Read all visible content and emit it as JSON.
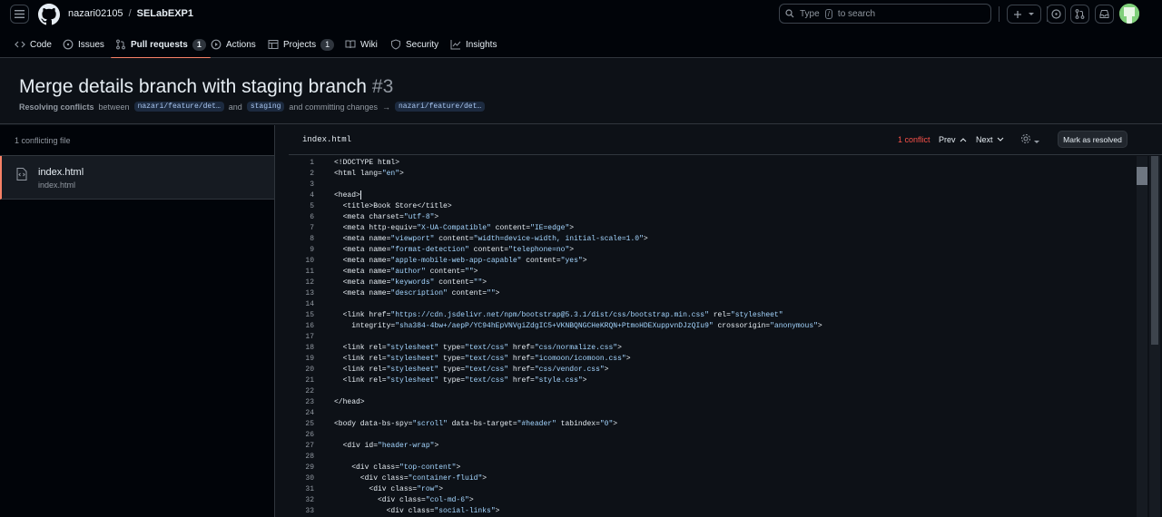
{
  "header": {
    "owner": "nazari02105",
    "separator": "/",
    "repo": "SELabEXP1",
    "search": {
      "prefix": "Type",
      "key": "/",
      "suffix": "to search"
    }
  },
  "tabs": [
    {
      "label": "Code",
      "icon": "code-icon"
    },
    {
      "label": "Issues",
      "icon": "issue-icon"
    },
    {
      "label": "Pull requests",
      "icon": "pull-request-icon",
      "count": "1",
      "active": true
    },
    {
      "label": "Actions",
      "icon": "play-icon"
    },
    {
      "label": "Projects",
      "icon": "table-icon",
      "count": "1"
    },
    {
      "label": "Wiki",
      "icon": "book-icon"
    },
    {
      "label": "Security",
      "icon": "shield-icon"
    },
    {
      "label": "Insights",
      "icon": "graph-icon"
    }
  ],
  "pr": {
    "title": "Merge details branch with staging branch",
    "number": "#3",
    "sub": {
      "action": "Resolving conflicts",
      "between": "between",
      "head": "nazari/feature/det…",
      "and": "and",
      "base": "staging",
      "committing": "and committing changes",
      "arrow": "→",
      "target": "nazari/feature/det…"
    }
  },
  "files": {
    "header": "1 conflicting file",
    "items": [
      {
        "name": "index.html",
        "path": "index.html"
      }
    ]
  },
  "editor": {
    "filename": "index.html",
    "conflicts": "1 conflict",
    "prev": "Prev",
    "next": "Next",
    "resolve": "Mark as resolved",
    "lines": [
      {
        "n": "1",
        "code": "<!DOCTYPE html>"
      },
      {
        "n": "2",
        "code": "<html lang=\"en\">"
      },
      {
        "n": "3",
        "code": ""
      },
      {
        "n": "4",
        "code": "<head>"
      },
      {
        "n": "5",
        "code": "  <title>Book Store</title>"
      },
      {
        "n": "6",
        "code": "  <meta charset=\"utf-8\">"
      },
      {
        "n": "7",
        "code": "  <meta http-equiv=\"X-UA-Compatible\" content=\"IE=edge\">"
      },
      {
        "n": "8",
        "code": "  <meta name=\"viewport\" content=\"width=device-width, initial-scale=1.0\">"
      },
      {
        "n": "9",
        "code": "  <meta name=\"format-detection\" content=\"telephone=no\">"
      },
      {
        "n": "10",
        "code": "  <meta name=\"apple-mobile-web-app-capable\" content=\"yes\">"
      },
      {
        "n": "11",
        "code": "  <meta name=\"author\" content=\"\">"
      },
      {
        "n": "12",
        "code": "  <meta name=\"keywords\" content=\"\">"
      },
      {
        "n": "13",
        "code": "  <meta name=\"description\" content=\"\">"
      },
      {
        "n": "14",
        "code": ""
      },
      {
        "n": "15",
        "code": "  <link href=\"https://cdn.jsdelivr.net/npm/bootstrap@5.3.1/dist/css/bootstrap.min.css\" rel=\"stylesheet\""
      },
      {
        "n": "16",
        "code": "    integrity=\"sha384-4bw+/aepP/YC94hEpVNVgiZdgIC5+VKNBQNGCHeKRQN+PtmoHDEXuppvnDJzQIu9\" crossorigin=\"anonymous\">"
      },
      {
        "n": "17",
        "code": ""
      },
      {
        "n": "18",
        "code": "  <link rel=\"stylesheet\" type=\"text/css\" href=\"css/normalize.css\">"
      },
      {
        "n": "19",
        "code": "  <link rel=\"stylesheet\" type=\"text/css\" href=\"icomoon/icomoon.css\">"
      },
      {
        "n": "20",
        "code": "  <link rel=\"stylesheet\" type=\"text/css\" href=\"css/vendor.css\">"
      },
      {
        "n": "21",
        "code": "  <link rel=\"stylesheet\" type=\"text/css\" href=\"style.css\">"
      },
      {
        "n": "22",
        "code": ""
      },
      {
        "n": "23",
        "code": "</head>"
      },
      {
        "n": "24",
        "code": ""
      },
      {
        "n": "25",
        "code": "<body data-bs-spy=\"scroll\" data-bs-target=\"#header\" tabindex=\"0\">"
      },
      {
        "n": "26",
        "code": ""
      },
      {
        "n": "27",
        "code": "  <div id=\"header-wrap\">"
      },
      {
        "n": "28",
        "code": ""
      },
      {
        "n": "29",
        "code": "    <div class=\"top-content\">"
      },
      {
        "n": "30",
        "code": "      <div class=\"container-fluid\">"
      },
      {
        "n": "31",
        "code": "        <div class=\"row\">"
      },
      {
        "n": "32",
        "code": "          <div class=\"col-md-6\">"
      },
      {
        "n": "33",
        "code": "            <div class=\"social-links\">"
      }
    ]
  }
}
